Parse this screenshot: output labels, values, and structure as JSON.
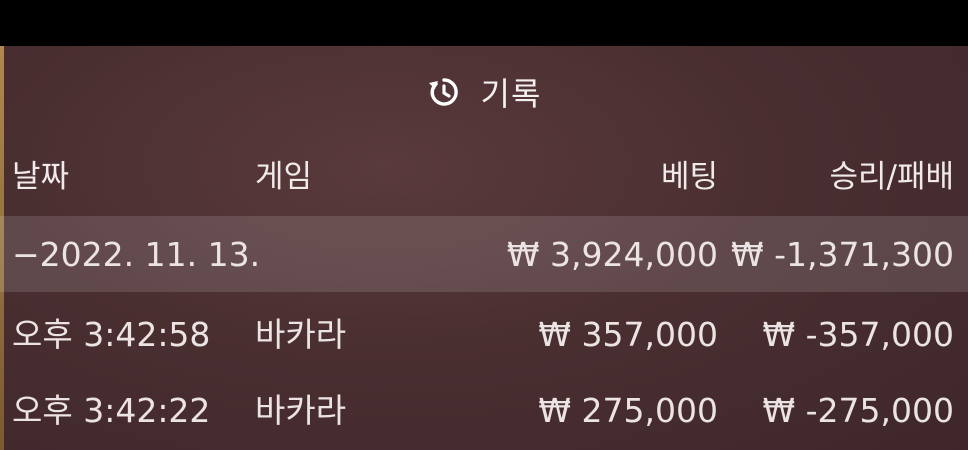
{
  "header": {
    "icon": "history-icon",
    "title": "기록"
  },
  "columns": {
    "date": "날짜",
    "game": "게임",
    "bet": "베팅",
    "result": "승리/패배"
  },
  "summary": {
    "date": "−2022. 11. 13.",
    "bet": "₩ 3,924,000",
    "result": "₩ -1,371,300"
  },
  "rows": [
    {
      "time": "오후 3:42:58",
      "game": "바카라",
      "bet": "₩ 357,000",
      "result": "₩ -357,000"
    },
    {
      "time": "오후 3:42:22",
      "game": "바카라",
      "bet": "₩ 275,000",
      "result": "₩ -275,000"
    }
  ],
  "colors": {
    "background": "#4a2f31",
    "summary_row": "#6b5355",
    "text": "#ece4e4"
  }
}
